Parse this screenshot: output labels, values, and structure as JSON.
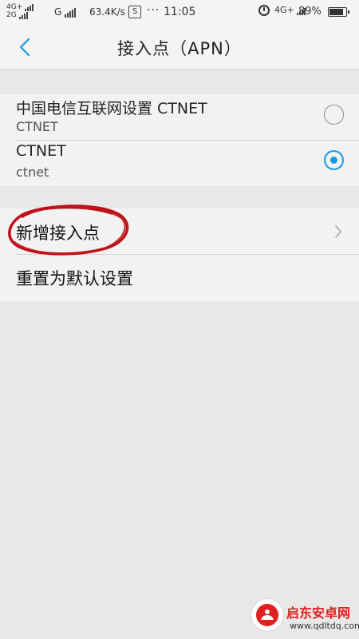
{
  "status_bar": {
    "net_top": "4G+",
    "net_bottom": "2G",
    "net2": "G",
    "speed": "63.4K/s",
    "s_badge": "S",
    "dots": "···",
    "time": "11:05",
    "net_right": "4G+",
    "battery": "89%",
    "battery_level": 0.89
  },
  "header": {
    "title": "接入点（APN）",
    "back_icon": "chevron-left-icon"
  },
  "apn_list": [
    {
      "name": "中国电信互联网设置 CTNET",
      "apn": "CTNET",
      "selected": false
    },
    {
      "name": "CTNET",
      "apn": "ctnet",
      "selected": true
    }
  ],
  "actions": [
    {
      "label": "新增接入点",
      "icon": "chevron-right-icon"
    },
    {
      "label": "重置为默认设置"
    }
  ],
  "watermark": {
    "name": "启东安卓网",
    "url": "www.qdltdq.com"
  },
  "colors": {
    "accent": "#1a9ae0",
    "annotation": "#c0101a",
    "watermark_red": "#e0201f"
  }
}
